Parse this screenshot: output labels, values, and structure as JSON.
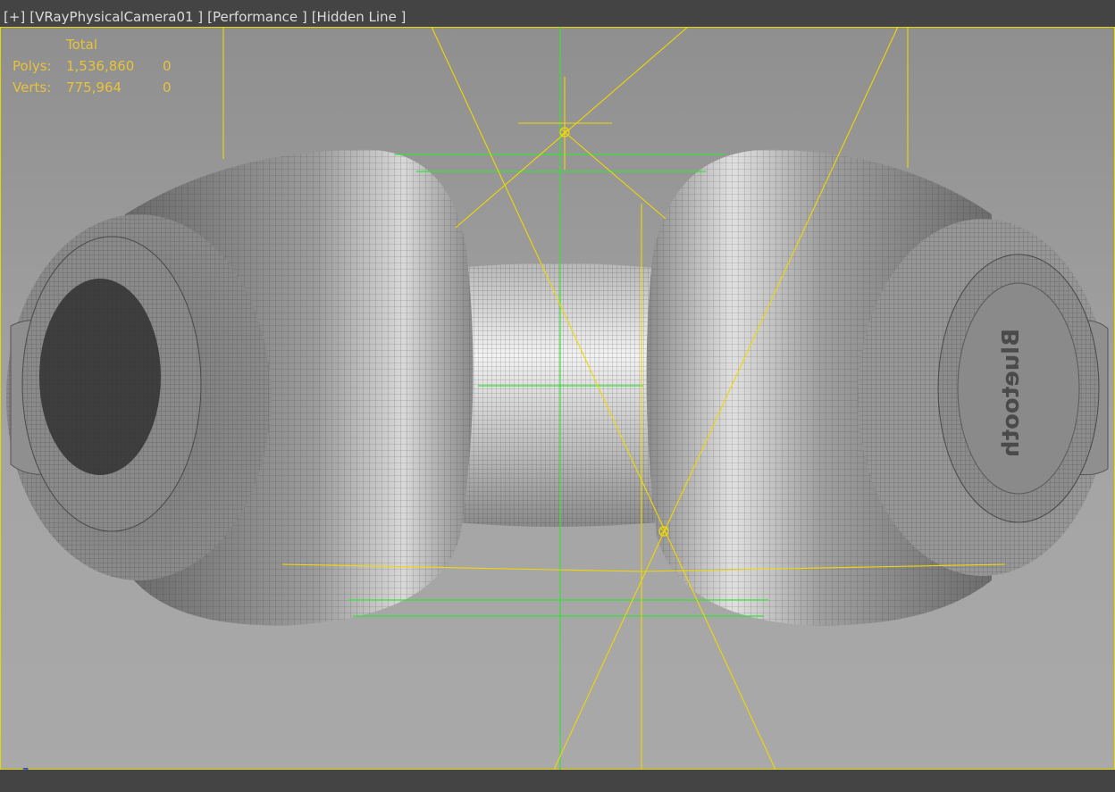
{
  "viewport_menu": {
    "plus": "[+]",
    "camera": "[VRayPhysicalCamera01 ]",
    "shading_performance": "[Performance ]",
    "shading_mode": "[Hidden Line ]"
  },
  "stats": {
    "header": "Total",
    "polys_label": "Polys:",
    "polys_total": "1,536,860",
    "polys_selected": "0",
    "verts_label": "Verts:",
    "verts_total": "775,964",
    "verts_selected": "0"
  },
  "axis": {
    "z": "z",
    "x": "x"
  },
  "model": {
    "name": "headphones-wireframe",
    "logo_text": "Bluetooth"
  },
  "colors": {
    "viewport_border": "#e6d700",
    "camera_frustum": "#f0d800",
    "target_bbox": "#39e039",
    "stats_text": "#e8c23a",
    "mesh_fill": "#9a9a9a"
  }
}
